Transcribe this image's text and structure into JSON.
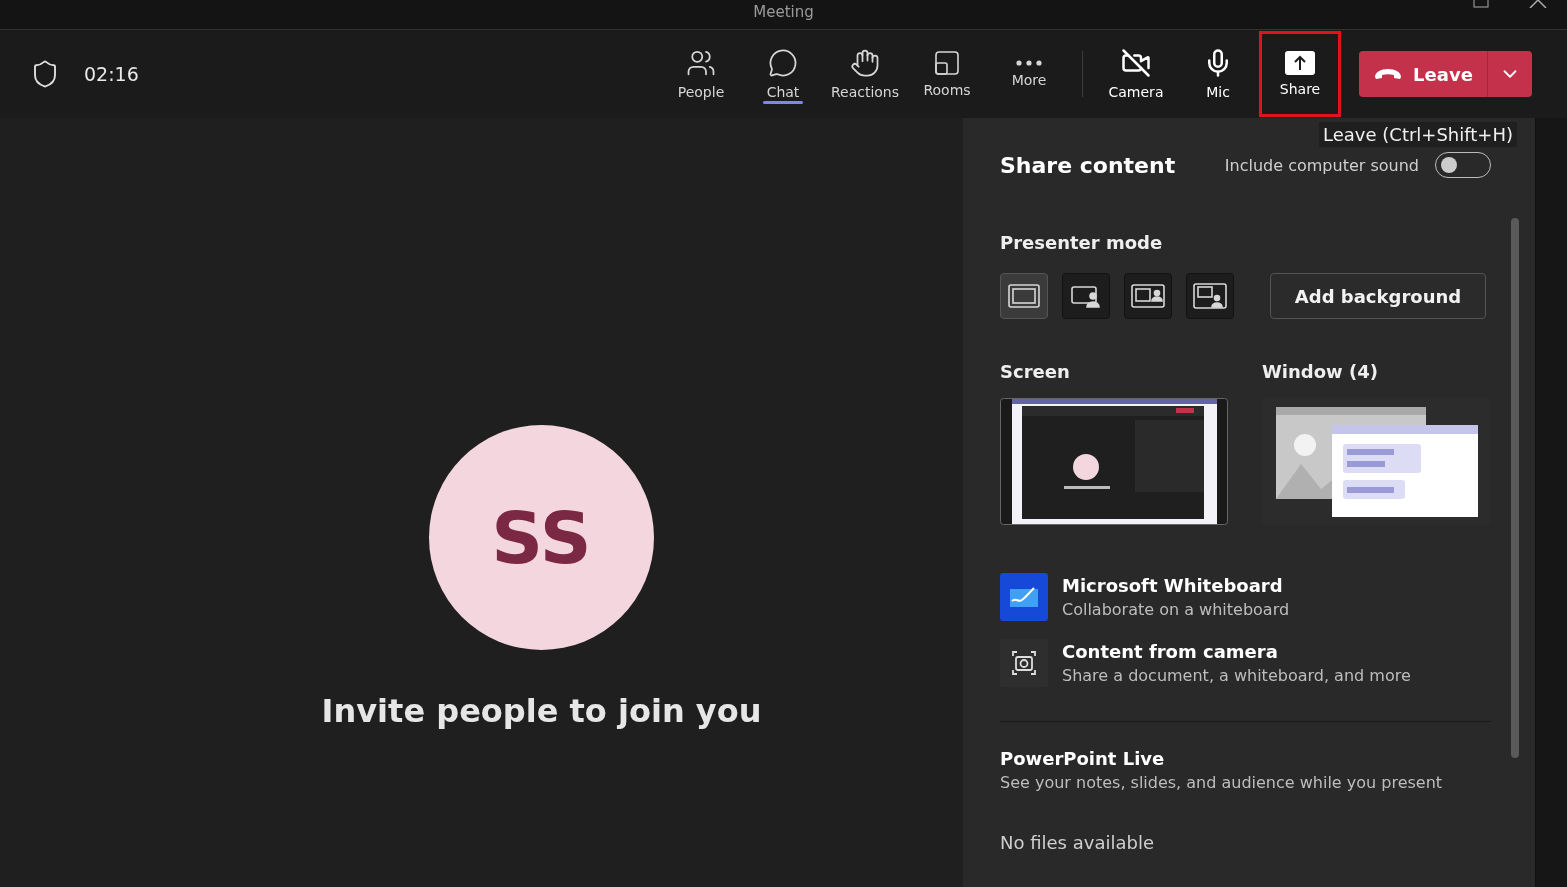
{
  "window": {
    "title": "Meeting"
  },
  "call": {
    "elapsed": "02:16"
  },
  "toolbar": [
    {
      "kind": "people",
      "label": "People",
      "selected": false,
      "highlighted": false
    },
    {
      "kind": "chat",
      "label": "Chat",
      "selected": true,
      "highlighted": false
    },
    {
      "kind": "reactions",
      "label": "Reactions",
      "selected": false,
      "highlighted": false
    },
    {
      "kind": "rooms",
      "label": "Rooms",
      "selected": false,
      "highlighted": false
    },
    {
      "kind": "more",
      "label": "More",
      "selected": false,
      "highlighted": false
    },
    {
      "kind": "camera",
      "label": "Camera",
      "selected": false,
      "highlighted": false,
      "on": false
    },
    {
      "kind": "mic",
      "label": "Mic",
      "selected": false,
      "highlighted": false,
      "on": true
    },
    {
      "kind": "share",
      "label": "Share",
      "selected": false,
      "highlighted": true
    }
  ],
  "leave_button": {
    "label": "Leave",
    "tooltip": "Leave (Ctrl+Shift+H)"
  },
  "stage": {
    "avatar_initials": "SS",
    "message": "Invite people to join you"
  },
  "share_panel": {
    "title": "Share content",
    "computer_sound": {
      "label": "Include computer sound",
      "on": false
    },
    "presenter_mode": {
      "heading": "Presenter mode",
      "modes": [
        {
          "kind": "content",
          "selected": true
        },
        {
          "kind": "standout",
          "selected": false
        },
        {
          "kind": "side",
          "selected": false
        },
        {
          "kind": "reporter",
          "selected": false
        }
      ],
      "add_background": "Add background"
    },
    "screen": {
      "heading": "Screen"
    },
    "window": {
      "heading": "Window (4)"
    },
    "apps": [
      {
        "kind": "whiteboard",
        "title": "Microsoft Whiteboard",
        "subtitle": "Collaborate on a whiteboard"
      },
      {
        "kind": "camera",
        "title": "Content from camera",
        "subtitle": "Share a document, a whiteboard, and more"
      }
    ],
    "powerpoint": {
      "title": "PowerPoint Live",
      "subtitle": "See your notes, slides, and audience while you present",
      "empty": "No files available"
    }
  }
}
